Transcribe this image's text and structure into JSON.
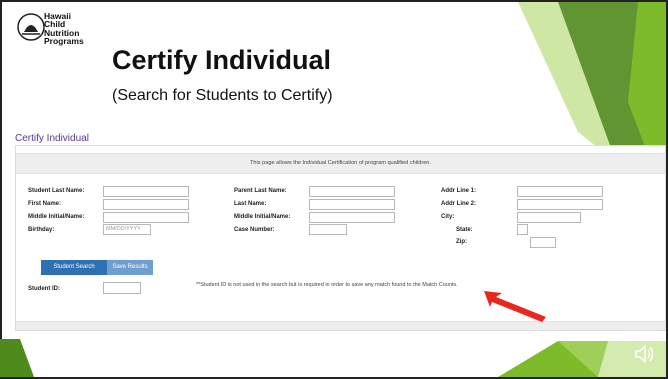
{
  "logo": {
    "line1": "Hawaii",
    "line2": "Child",
    "line3": "Nutrition",
    "line4": "Programs"
  },
  "slide": {
    "title": "Certify Individual",
    "subtitle": "(Search for Students to Certify)"
  },
  "app": {
    "link_label": "Certify Individual",
    "info_text": "This page allows the Individual Certification of program qualified children.",
    "fields": {
      "student_last_name": "Student Last Name:",
      "first_name": "First Name:",
      "middle_initial": "Middle Initial/Name:",
      "birthday": "Birthday:",
      "birthday_placeholder": "MM/DD/YYYY",
      "parent_last_name": "Parent Last Name:",
      "last_name": "Last Name:",
      "parent_middle_initial": "Middle Initial/Name:",
      "case_number": "Case Number:",
      "addr_line1": "Addr Line 1:",
      "addr_line2": "Addr Line 2:",
      "city": "City:",
      "state": "State:",
      "zip": "Zip:",
      "student_id": "Student ID:"
    },
    "buttons": {
      "search": "Student Search",
      "save": "Save Results"
    },
    "note": "**Student ID is not used in the search but is required in order to save any match found to the Match Counts."
  },
  "colors": {
    "accent_green": "#7dbb2a",
    "dark_green": "#4f8a1c",
    "button_blue": "#2f6fb3",
    "arrow_red": "#e8281e"
  }
}
